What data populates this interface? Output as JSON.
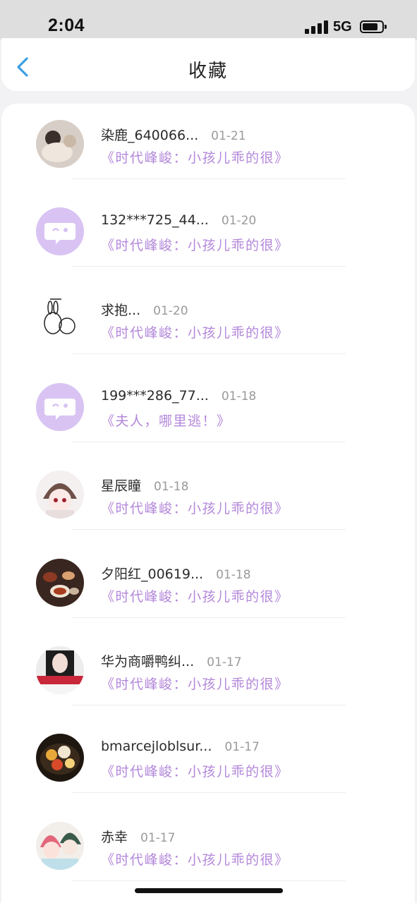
{
  "status_bar": {
    "time": "2:04",
    "network": "5G",
    "battery_level": 0.8
  },
  "header": {
    "title": "收藏",
    "back_icon": "chevron-left-icon"
  },
  "colors": {
    "accent": "#3d9fe3",
    "book_title": "#b387da",
    "date": "#9a9a9a"
  },
  "favorites": [
    {
      "name": "染鹿_640066...",
      "date": "01-21",
      "book": "《时代峰峻：小孩儿乖的很》",
      "avatar": "photo"
    },
    {
      "name": "132***725_44...",
      "date": "01-20",
      "book": "《时代峰峻：小孩儿乖的很》",
      "avatar": "default-chat-icon"
    },
    {
      "name": "求抱...",
      "date": "01-20",
      "book": "《时代峰峻：小孩儿乖的很》",
      "avatar": "sketch"
    },
    {
      "name": "199***286_77...",
      "date": "01-18",
      "book": "《夫人，哪里逃！》",
      "avatar": "default-chat-icon"
    },
    {
      "name": "星辰瞳",
      "date": "01-18",
      "book": "《时代峰峻：小孩儿乖的很》",
      "avatar": "anime"
    },
    {
      "name": "夕阳红_00619...",
      "date": "01-18",
      "book": "《时代峰峻：小孩儿乖的很》",
      "avatar": "photo"
    },
    {
      "name": "华为商嚼鸭纠...",
      "date": "01-17",
      "book": "《时代峰峻：小孩儿乖的很》",
      "avatar": "photo"
    },
    {
      "name": "bmarcejloblsur...",
      "date": "01-17",
      "book": "《时代峰峻：小孩儿乖的很》",
      "avatar": "photo"
    },
    {
      "name": "赤幸",
      "date": "01-17",
      "book": "《时代峰峻：小孩儿乖的很》",
      "avatar": "anime"
    }
  ]
}
